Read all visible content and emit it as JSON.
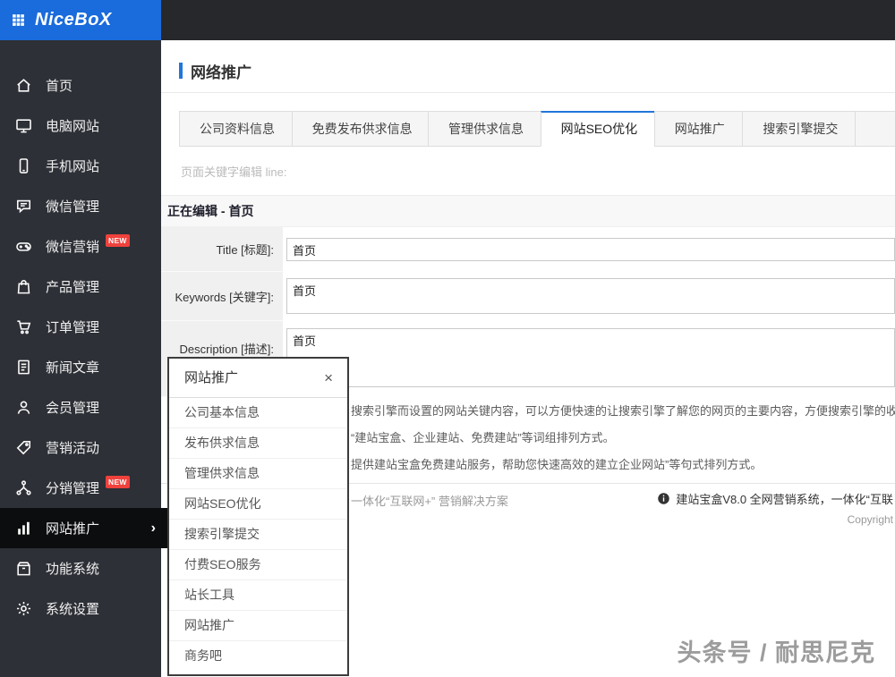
{
  "topbar": {
    "logo": "NiceBoX",
    "icons": [
      {
        "icon": "monitor"
      },
      {
        "icon": "phone"
      },
      {
        "icon": "chat"
      }
    ]
  },
  "sidebar": {
    "items": [
      {
        "label": "首页",
        "icon": "home"
      },
      {
        "label": "电脑网站",
        "icon": "monitor"
      },
      {
        "label": "手机网站",
        "icon": "phone"
      },
      {
        "label": "微信管理",
        "icon": "chat"
      },
      {
        "label": "微信营销",
        "icon": "gamepad",
        "badge": "NEW"
      },
      {
        "label": "产品管理",
        "icon": "bag"
      },
      {
        "label": "订单管理",
        "icon": "cart"
      },
      {
        "label": "新闻文章",
        "icon": "doc"
      },
      {
        "label": "会员管理",
        "icon": "user"
      },
      {
        "label": "营销活动",
        "icon": "tag"
      },
      {
        "label": "分销管理",
        "icon": "share",
        "badge": "NEW"
      },
      {
        "label": "网站推广",
        "icon": "chart",
        "active": true,
        "arrow": "›"
      },
      {
        "label": "功能系统",
        "icon": "box"
      },
      {
        "label": "系统设置",
        "icon": "gear"
      }
    ]
  },
  "main": {
    "page_title": "网络推广",
    "tabs": [
      {
        "label": "公司资料信息"
      },
      {
        "label": "免费发布供求信息"
      },
      {
        "label": "管理供求信息"
      },
      {
        "label": "网站SEO优化",
        "active": true
      },
      {
        "label": "网站推广"
      },
      {
        "label": "搜索引擎提交"
      },
      {
        "label": ""
      }
    ],
    "hint": "页面关键字编辑 line:",
    "editing_label": "正在编辑 - 首页",
    "form": {
      "title_label": "Title [标题]:",
      "title_value": "首页",
      "keywords_label": "Keywords [关键字]:",
      "keywords_value": "首页",
      "description_label": "Description [描述]:",
      "description_value": "首页"
    },
    "help_lines": [
      "搜索引擎而设置的网站关键内容，可以方便快速的让搜索引擎了解您的网页的主要内容，方便搜索引擎的收录。",
      "“建站宝盒、企业建站、免费建站”等词组排列方式。",
      "提供建站宝盒免费建站服务，帮助您快速高效的建立企业网站”等句式排列方式。"
    ],
    "footer": {
      "left": "一体化“互联网+” 营销解决方案",
      "right": "建站宝盒V8.0 全网营销系统，一体化“互联",
      "copyright": "Copyright"
    },
    "watermark": "头条号 / 耐思尼克"
  },
  "popup": {
    "title": "网站推广",
    "close": "×",
    "items": [
      "公司基本信息",
      "发布供求信息",
      "管理供求信息",
      "网站SEO优化",
      "搜索引擎提交",
      "付费SEO服务",
      "站长工具",
      "网站推广",
      "商务吧"
    ]
  },
  "colors": {
    "primary_blue": "#1a6bdb",
    "tab_active_border": "#2176d9",
    "badge_red": "#f0413c",
    "sidebar_bg": "#2d3036",
    "topbar_bg": "#26282c"
  }
}
